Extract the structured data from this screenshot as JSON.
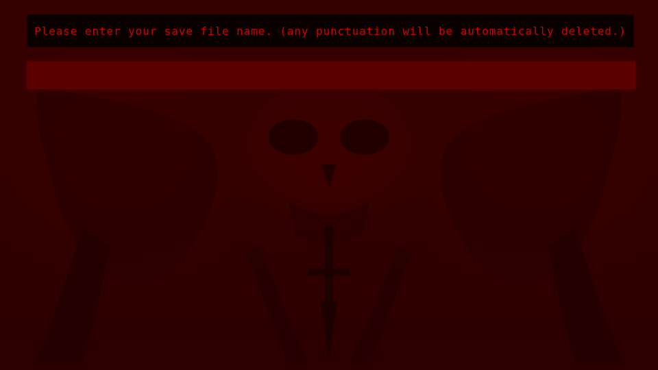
{
  "prompt": {
    "text": "Please enter your save file name. (any punctuation will be automatically deleted.)"
  },
  "save_name_input": {
    "value": "",
    "placeholder": ""
  },
  "colors": {
    "background": "#2a0000",
    "prompt_box": "#090000",
    "prompt_text": "#d40000",
    "input_fill": "#5c0000"
  },
  "background_art": {
    "icon": "demon-skull-with-inverted-cross-icon"
  }
}
